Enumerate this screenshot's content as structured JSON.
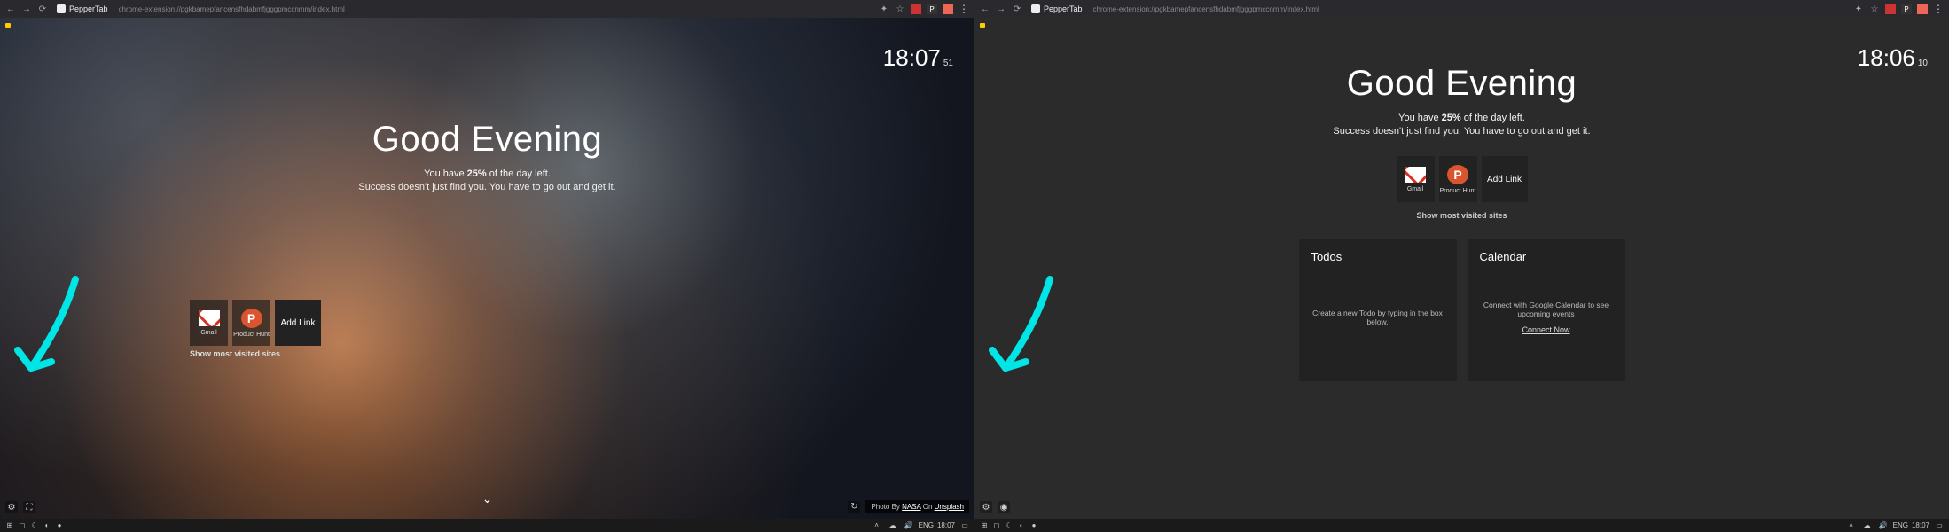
{
  "chrome": {
    "tab_title": "PepperTab",
    "url": "chrome-extension://pgkbamepfancensfhdabmfjgggpmccnmm/index.html",
    "ext_labels": [
      "",
      "P",
      ""
    ],
    "menu_glyph": "⋮"
  },
  "left": {
    "clock_hm": "18:07",
    "clock_s": "51",
    "greeting": "Good Evening",
    "dayleft_pre": "You have",
    "dayleft_pct": "25%",
    "dayleft_post": "of the day left.",
    "quote": "Success doesn't just find you. You have to go out and get it.",
    "link1_label": "Gmail",
    "link2_label": "Product Hunt",
    "add_link": "Add Link",
    "smvs": "Show most visited sites",
    "credit_pre": "Photo By",
    "credit_author": "NASA",
    "credit_mid": "On",
    "credit_src": "Unsplash"
  },
  "right": {
    "clock_hm": "18:06",
    "clock_s": "10",
    "greeting": "Good Evening",
    "dayleft_pre": "You have",
    "dayleft_pct": "25%",
    "dayleft_post": "of the day left.",
    "quote": "Success doesn't just find you. You have to go out and get it.",
    "link1_label": "Gmail",
    "link2_label": "Product Hunt",
    "add_link": "Add Link",
    "smvs": "Show most visited sites",
    "todos_title": "Todos",
    "todos_hint": "Create a new Todo by typing in the box below.",
    "cal_title": "Calendar",
    "cal_hint": "Connect with Google Calendar to see upcoming events",
    "cal_link": "Connect Now"
  },
  "taskbar": {
    "lang": "ENG",
    "time_left": "18:07",
    "time_right": "18:07"
  }
}
